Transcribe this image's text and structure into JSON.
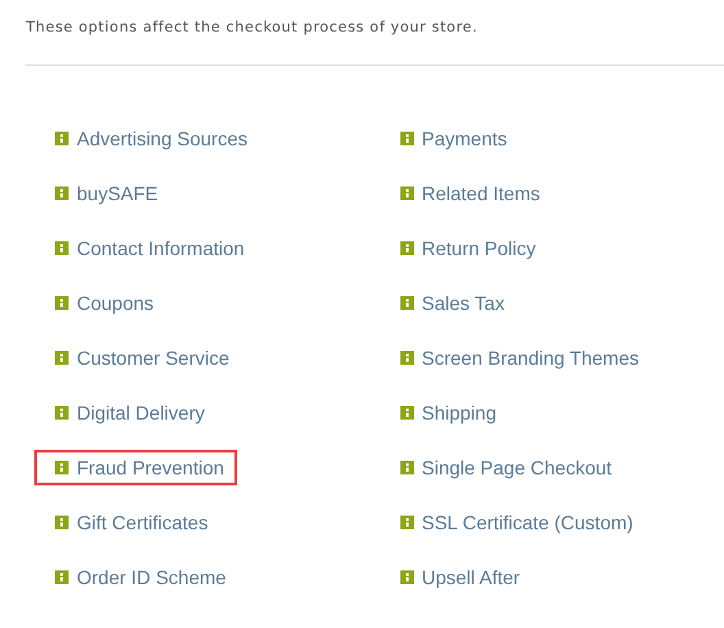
{
  "description": "These options affect the checkout process of your store.",
  "columns": [
    [
      {
        "label": "Advertising Sources",
        "highlighted": false
      },
      {
        "label": "buySAFE",
        "highlighted": false
      },
      {
        "label": "Contact Information",
        "highlighted": false
      },
      {
        "label": "Coupons",
        "highlighted": false
      },
      {
        "label": "Customer Service",
        "highlighted": false
      },
      {
        "label": "Digital Delivery",
        "highlighted": false
      },
      {
        "label": "Fraud Prevention",
        "highlighted": true
      },
      {
        "label": "Gift Certificates",
        "highlighted": false
      },
      {
        "label": "Order ID Scheme",
        "highlighted": false
      }
    ],
    [
      {
        "label": "Payments",
        "highlighted": false
      },
      {
        "label": "Related Items",
        "highlighted": false
      },
      {
        "label": "Return Policy",
        "highlighted": false
      },
      {
        "label": "Sales Tax",
        "highlighted": false
      },
      {
        "label": "Screen Branding Themes",
        "highlighted": false
      },
      {
        "label": "Shipping",
        "highlighted": false
      },
      {
        "label": "Single Page Checkout",
        "highlighted": false
      },
      {
        "label": "SSL Certificate (Custom)",
        "highlighted": false
      },
      {
        "label": "Upsell After",
        "highlighted": false
      }
    ]
  ]
}
